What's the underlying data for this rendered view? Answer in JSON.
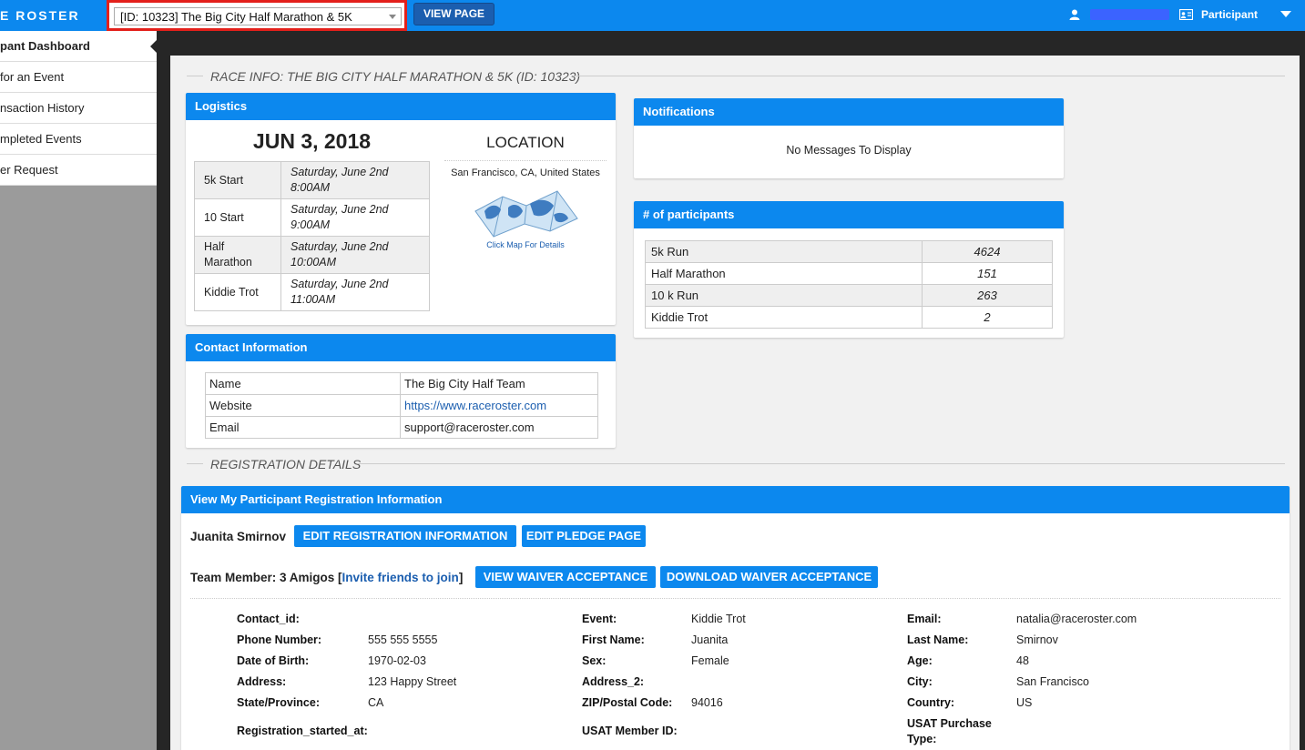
{
  "topbar": {
    "logo": "E ROSTER",
    "event_select_value": "[ID: 10323] The Big City Half Marathon & 5K",
    "view_page_label": "VIEW PAGE",
    "role_label": "Participant"
  },
  "sidebar": {
    "items": [
      {
        "label": "pant Dashboard"
      },
      {
        "label": "for an Event"
      },
      {
        "label": "nsaction History"
      },
      {
        "label": "mpleted Events"
      },
      {
        "label": "er Request"
      }
    ]
  },
  "race_info": {
    "heading": "RACE INFO: THE BIG CITY HALF MARATHON & 5K (ID: 10323)"
  },
  "logistics": {
    "header": "Logistics",
    "date": "JUN 3, 2018",
    "schedule": [
      {
        "name": "5k Start",
        "time_line1": "Saturday, June 2nd",
        "time_line2": "8:00AM"
      },
      {
        "name": "10 Start",
        "time_line1": "Saturday, June 2nd",
        "time_line2": "9:00AM"
      },
      {
        "name": "Half Marathon",
        "time_line1": "Saturday, June 2nd",
        "time_line2": "10:00AM"
      },
      {
        "name": "Kiddie Trot",
        "time_line1": "Saturday, June 2nd",
        "time_line2": "11:00AM"
      }
    ],
    "location_title": "LOCATION",
    "location_city": "San Francisco, CA, United States",
    "map_caption": "Click Map For Details"
  },
  "notifications": {
    "header": "Notifications",
    "message": "No Messages To Display"
  },
  "participants": {
    "header": "# of participants",
    "rows": [
      {
        "name": "5k Run",
        "count": "4624"
      },
      {
        "name": "Half Marathon",
        "count": "151"
      },
      {
        "name": "10 k Run",
        "count": "263"
      },
      {
        "name": "Kiddie Trot",
        "count": "2"
      }
    ]
  },
  "contact": {
    "header": "Contact Information",
    "rows": [
      {
        "label": "Name",
        "value": "The Big City Half Team"
      },
      {
        "label": "Website",
        "value": "https://www.raceroster.com"
      },
      {
        "label": "Email",
        "value": "support@raceroster.com"
      }
    ]
  },
  "registration": {
    "heading": "REGISTRATION DETAILS",
    "header": "View My Participant Registration Information",
    "participant_name": "Juanita Smirnov",
    "edit_registration_label": "EDIT REGISTRATION INFORMATION",
    "edit_pledge_label": "EDIT PLEDGE PAGE",
    "team_prefix": "Team Member: 3 Amigos [",
    "invite_link": "Invite friends to join",
    "team_suffix": "]",
    "view_waiver_label": "VIEW WAIVER ACCEPTANCE",
    "download_waiver_label": "DOWNLOAD WAIVER ACCEPTANCE",
    "fields": {
      "contact_id": {
        "label": "Contact_id:",
        "value": ""
      },
      "phone": {
        "label": "Phone Number:",
        "value": "555 555 5555"
      },
      "dob": {
        "label": "Date of Birth:",
        "value": "1970-02-03"
      },
      "address": {
        "label": "Address:",
        "value": "123 Happy Street"
      },
      "state": {
        "label": "State/Province:",
        "value": "CA"
      },
      "reg_started": {
        "label": "Registration_started_at:",
        "value": ""
      },
      "event": {
        "label": "Event:",
        "value": "Kiddie Trot"
      },
      "first_name": {
        "label": "First Name:",
        "value": "Juanita"
      },
      "sex": {
        "label": "Sex:",
        "value": "Female"
      },
      "address_2": {
        "label": "Address_2:",
        "value": ""
      },
      "zip": {
        "label": "ZIP/Postal Code:",
        "value": "94016"
      },
      "usat_id": {
        "label": "USAT Member ID:",
        "value": ""
      },
      "email": {
        "label": "Email:",
        "value": "natalia@raceroster.com"
      },
      "last_name": {
        "label": "Last Name:",
        "value": "Smirnov"
      },
      "age": {
        "label": "Age:",
        "value": "48"
      },
      "city": {
        "label": "City:",
        "value": "San Francisco"
      },
      "country": {
        "label": "Country:",
        "value": "US"
      },
      "usat_purchase_l1": {
        "label": "USAT Purchase",
        "value": ""
      },
      "usat_purchase_l2": {
        "label": "Type:",
        "value": ""
      }
    }
  },
  "colors": {
    "primary": "#0c88ee",
    "dark_button": "#1b5eaf",
    "highlight": "#e3201b"
  }
}
